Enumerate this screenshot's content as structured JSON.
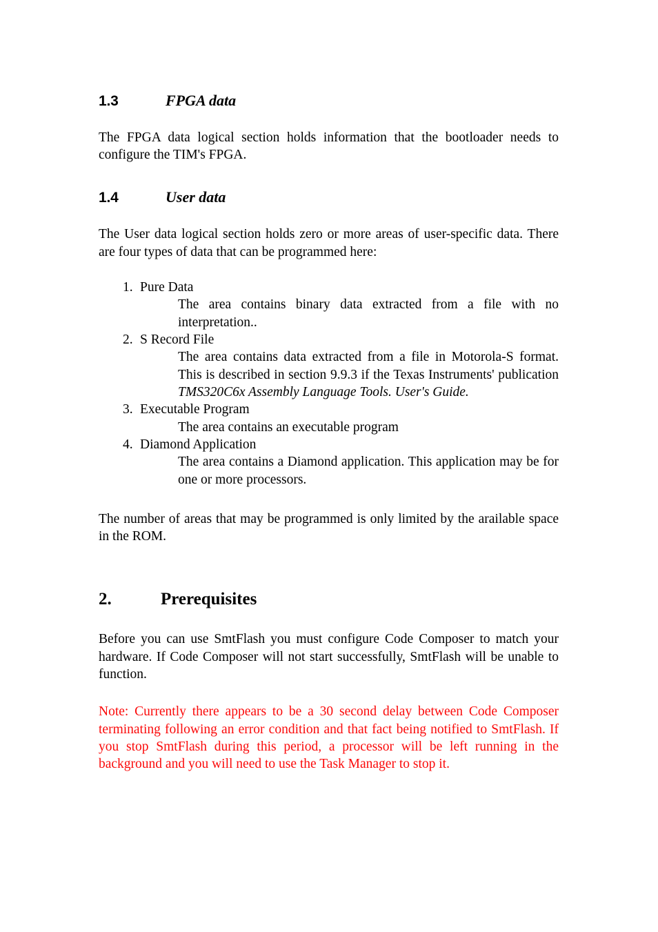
{
  "document": {
    "colors": {
      "text": "#000000",
      "note": "#fb0a0a",
      "background": "#ffffff"
    },
    "sections": {
      "fpga": {
        "number": "1.3",
        "title": "FPGA data",
        "body": "The FPGA data logical section holds information that the bootloader needs to configure the TIM's FPGA."
      },
      "user_data": {
        "number": "1.4",
        "title": "User data",
        "intro": "The User data logical section holds zero or more areas of user-specific data. There are four types of data that can be programmed here:",
        "items": [
          {
            "marker": "1.",
            "title": "Pure Data",
            "description": "The area contains binary data extracted from a file with no interpretation.."
          },
          {
            "marker": "2.",
            "title": "S Record File",
            "description_before": "The area contains data extracted from a file in Motorola-S format. This is described in section 9.9.3 if the Texas Instruments' publication ",
            "description_italic": "TMS320C6x Assembly Language Tools. User's Guide."
          },
          {
            "marker": "3.",
            "title": "Executable Program",
            "description": "The area contains an executable program"
          },
          {
            "marker": "4.",
            "title": "Diamond Application",
            "description": "The area contains a Diamond application. This application may be for one or more processors."
          }
        ],
        "closing": "The number of areas that may be programmed is only limited by the arailable space in the ROM."
      },
      "prerequisites": {
        "number": "2.",
        "title": "Prerequisites",
        "body": "Before you can use SmtFlash you must configure Code Composer to match your hardware. If Code Composer will not start successfully, SmtFlash will be unable to function.",
        "note": "Note: Currently there appears to be a 30 second delay between Code Composer terminating following an error condition and that fact being notified to SmtFlash. If you stop SmtFlash during this period, a processor will be left running in the background and you will need to use the Task Manager to stop it."
      }
    }
  }
}
